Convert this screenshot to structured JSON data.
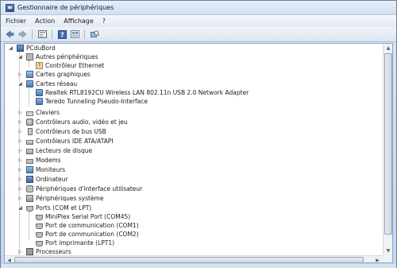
{
  "window": {
    "title": "Gestionnaire de périphériques"
  },
  "menu": [
    "Fichier",
    "Action",
    "Affichage",
    "?"
  ],
  "toolbar": {
    "icons": [
      "back-arrow-icon",
      "forward-arrow-icon",
      "properties-icon",
      "help-icon",
      "scan-hardware-icon"
    ]
  },
  "tree": {
    "root": "PCduBord",
    "items": [
      {
        "label": "Autres périphériques",
        "icon": "unknown-device-icon",
        "expanded": true
      },
      {
        "label": "Contrôleur Ethernet",
        "icon": "warning-device-icon",
        "child": true
      },
      {
        "label": "Cartes graphiques",
        "icon": "display-adapter-icon",
        "expanded": false
      },
      {
        "label": "Cartes réseau",
        "icon": "network-adapter-icon",
        "expanded": true
      },
      {
        "label": "Realtek RTL8192CU Wireless LAN 802.11n USB 2.0 Network Adapter",
        "icon": "network-adapter-icon",
        "child": true
      },
      {
        "label": "Teredo Tunneling Pseudo-Interface",
        "icon": "network-adapter-icon",
        "child": true
      },
      {
        "label": "Claviers",
        "icon": "keyboard-icon",
        "expanded": false
      },
      {
        "label": "Contrôleurs audio, vidéo et jeu",
        "icon": "audio-icon",
        "expanded": false
      },
      {
        "label": "Contrôleurs de bus USB",
        "icon": "usb-icon",
        "expanded": false
      },
      {
        "label": "Contrôleurs IDE ATA/ATAPI",
        "icon": "ide-controller-icon",
        "expanded": false
      },
      {
        "label": "Lecteurs de disque",
        "icon": "disk-drive-icon",
        "expanded": false
      },
      {
        "label": "Modems",
        "icon": "modem-icon",
        "expanded": false
      },
      {
        "label": "Moniteurs",
        "icon": "monitor-icon",
        "expanded": false
      },
      {
        "label": "Ordinateur",
        "icon": "computer-icon",
        "expanded": false
      },
      {
        "label": "Périphériques d'interface utilisateur",
        "icon": "hid-icon",
        "expanded": false
      },
      {
        "label": "Périphériques système",
        "icon": "system-device-icon",
        "expanded": false
      },
      {
        "label": "Ports (COM et LPT)",
        "icon": "port-icon",
        "expanded": true
      },
      {
        "label": "MiniPlex Serial Port (COM45)",
        "icon": "port-icon",
        "child": true
      },
      {
        "label": "Port de communication (COM1)",
        "icon": "port-icon",
        "child": true
      },
      {
        "label": "Port de communication (COM2)",
        "icon": "port-icon",
        "child": true
      },
      {
        "label": "Port imprimante (LPT1)",
        "icon": "port-icon",
        "child": true
      },
      {
        "label": "Processeurs",
        "icon": "processor-icon",
        "expanded": false
      }
    ]
  }
}
